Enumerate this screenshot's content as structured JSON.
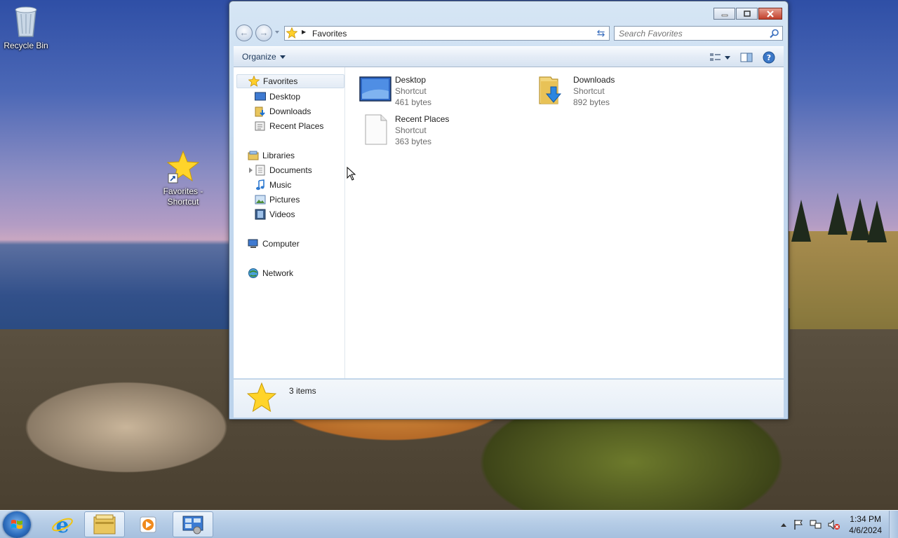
{
  "desktop": {
    "icons": [
      {
        "label": "Recycle Bin",
        "icon": "recycle-bin-icon"
      },
      {
        "label": "Favorites - Shortcut",
        "icon": "favorites-star-icon"
      }
    ]
  },
  "window": {
    "address": {
      "location": "Favorites"
    },
    "search": {
      "placeholder": "Search Favorites"
    },
    "toolbar": {
      "organize_label": "Organize"
    },
    "nav_pane": {
      "favorites": {
        "label": "Favorites",
        "items": [
          "Desktop",
          "Downloads",
          "Recent Places"
        ]
      },
      "libraries": {
        "label": "Libraries",
        "items": [
          "Documents",
          "Music",
          "Pictures",
          "Videos"
        ]
      },
      "computer": "Computer",
      "network": "Network"
    },
    "files": [
      {
        "name": "Desktop",
        "type": "Shortcut",
        "size": "461 bytes",
        "icon": "desktop-shortcut-icon"
      },
      {
        "name": "Downloads",
        "type": "Shortcut",
        "size": "892 bytes",
        "icon": "downloads-folder-icon"
      },
      {
        "name": "Recent Places",
        "type": "Shortcut",
        "size": "363 bytes",
        "icon": "blank-file-icon"
      }
    ],
    "details": {
      "item_count": "3 items"
    }
  },
  "taskbar": {
    "pinned": [
      "internet-explorer-icon",
      "windows-explorer-icon",
      "media-player-icon",
      "control-panel-icon"
    ],
    "clock": {
      "time": "1:34 PM",
      "date": "4/6/2024"
    }
  },
  "colors": {
    "accent": "#2f6fbf",
    "selection": "#e3ebf5",
    "close_button": "#c2402c"
  }
}
